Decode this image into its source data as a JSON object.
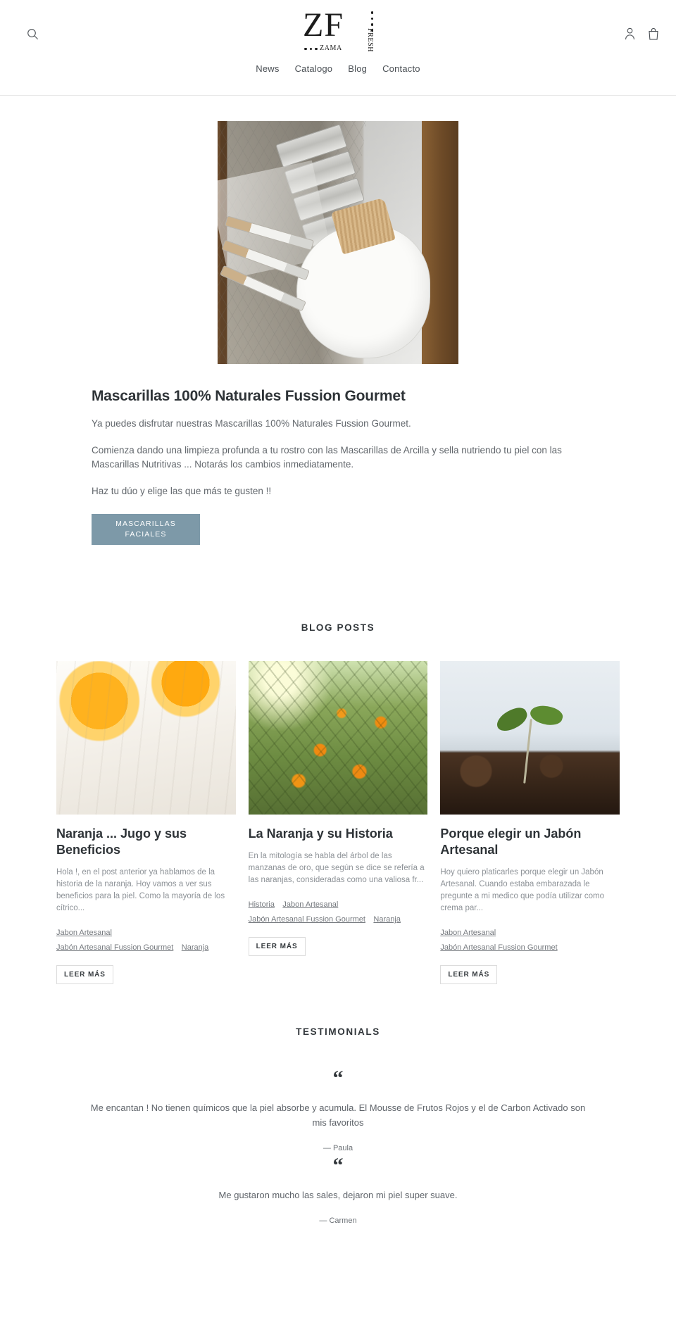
{
  "header": {
    "search_icon": "search-icon",
    "account_icon": "account-icon",
    "cart_icon": "cart-icon",
    "logo": {
      "mark": "ZF",
      "word_bottom": "ZAMA",
      "word_side": "FRESH"
    },
    "nav": [
      {
        "label": "News"
      },
      {
        "label": "Catalogo"
      },
      {
        "label": "Blog"
      },
      {
        "label": "Contacto"
      }
    ]
  },
  "feature": {
    "image_alt": "mascarillas-jars-and-brushes-photo",
    "title": "Mascarillas 100% Naturales Fussion Gourmet",
    "paragraphs": [
      "Ya puedes disfrutar nuestras Mascarillas 100% Naturales Fussion Gourmet.",
      "Comienza dando una limpieza profunda a tu rostro con las Mascarillas de Arcilla y sella nutriendo tu piel con las Mascarillas Nutritivas ... Notarás los cambios inmediatamente.",
      "Haz tu dúo y elige las que más te gusten !!"
    ],
    "button_label": "MASCARILLAS FACIALES",
    "button_color": "#7d99a8"
  },
  "blog": {
    "section_title": "BLOG POSTS",
    "read_more_label": "LEER MÁS",
    "posts": [
      {
        "thumb": "orange-slices-photo",
        "title": "Naranja ... Jugo y sus Beneficios",
        "excerpt": "Hola !, en el post anterior ya hablamos de la historia de la naranja. Hoy vamos a ver sus beneficios para la piel. Como la mayoría de los cítrico...",
        "tags": [
          "Jabon Artesanal",
          "Jabón Artesanal Fussion Gourmet",
          "Naranja"
        ]
      },
      {
        "thumb": "orange-tree-photo",
        "title": "La Naranja y su Historia",
        "excerpt": "En la mitología se habla del árbol de las manzanas de oro, que según se dice se refería a las naranjas, consideradas como una valiosa fr...",
        "tags": [
          "Historia",
          "Jabon Artesanal",
          "Jabón Artesanal Fussion Gourmet",
          "Naranja"
        ]
      },
      {
        "thumb": "sprout-in-soil-photo",
        "title": "Porque elegir un Jabón Artesanal",
        "excerpt": "Hoy quiero platicarles porque elegir un Jabón Artesanal. Cuando estaba embarazada le pregunte a mi medico que podía utilizar como crema par...",
        "tags": [
          "Jabon Artesanal",
          "Jabón Artesanal Fussion Gourmet"
        ]
      }
    ]
  },
  "testimonials": {
    "section_title": "TESTIMONIALS",
    "quote_glyph": "“",
    "items": [
      {
        "text": "Me encantan ! No tienen químicos que la piel absorbe y acumula. El Mousse de Frutos Rojos y el de Carbon Activado son mis favoritos",
        "author": "— Paula"
      },
      {
        "text": "Me gustaron mucho las sales, dejaron mi piel super suave.",
        "author": "— Carmen"
      }
    ]
  }
}
